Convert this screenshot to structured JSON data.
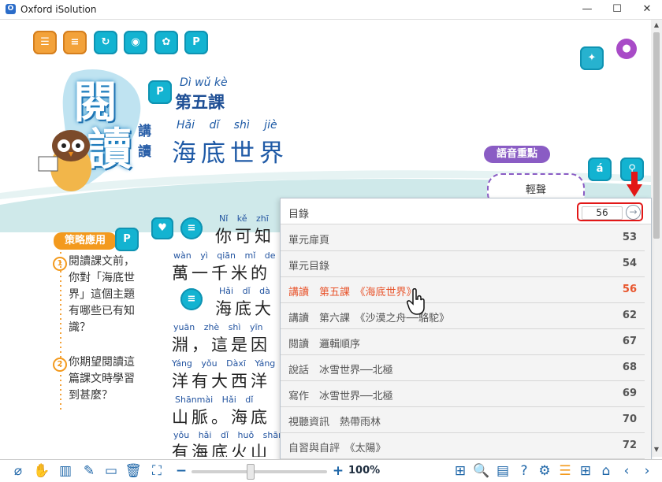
{
  "window": {
    "title": "Oxford iSolution",
    "logo_text": "O"
  },
  "header": {
    "brand_chars": [
      "閱",
      "讀"
    ],
    "side_label_top": "講",
    "side_label_bottom": "讀",
    "lesson_pinyin": "Dì wǔ kè",
    "lesson_title": "第五課",
    "lesson_name_pinyin": "Hǎi dǐ shì jiè",
    "lesson_name": "海底世界"
  },
  "speech_point": {
    "badge": "語音重點",
    "value": "輕聲"
  },
  "strategy": {
    "tag": "策略應用",
    "items": [
      {
        "num": "1",
        "lines": [
          "閱讀課文前，",
          "你對「海底世",
          "界」這個主題",
          "有哪些已有知",
          "識？"
        ]
      },
      {
        "num": "2",
        "lines": [
          "你期望閱讀這",
          "篇課文時學習",
          "到甚麼？"
        ]
      }
    ]
  },
  "lesson_lines": [
    {
      "py": "Nǐ kě zhī",
      "text": "你可知"
    },
    {
      "py": "wàn yì qiān mǐ de",
      "text": "萬一千米的"
    },
    {
      "py": "Hǎi dǐ dà",
      "text": "海底大"
    },
    {
      "py": "yuān zhè shì yīn",
      "text": "淵，這是因"
    },
    {
      "py": "Yáng yǒu Dàxī Yáng",
      "text": "洋有大西洋"
    },
    {
      "py": "Shānmài Hǎi dǐ",
      "text": "山脈。海底"
    },
    {
      "py": "yǒu hǎi dǐ huǒ shān",
      "text": "有海底火山"
    }
  ],
  "toc": {
    "title": "目錄",
    "page_input": "56",
    "go_icon": "arrow-right-circle-icon",
    "rows": [
      {
        "label": "單元扉頁",
        "page": "53",
        "active": false
      },
      {
        "label": "單元目錄",
        "page": "54",
        "active": false
      },
      {
        "label": "講讀　第五課　《海底世界》",
        "page": "56",
        "active": true
      },
      {
        "label": "講讀　第六課　《沙漠之舟──駱駝》",
        "page": "62",
        "active": false
      },
      {
        "label": "閱讀　邏輯順序",
        "page": "67",
        "active": false
      },
      {
        "label": "說話　冰雪世界──北極",
        "page": "68",
        "active": false
      },
      {
        "label": "寫作　冰雪世界──北極",
        "page": "69",
        "active": false
      },
      {
        "label": "視聽資訊　熱帶雨林",
        "page": "70",
        "active": false
      },
      {
        "label": "自習與自評　《太陽》",
        "page": "72",
        "active": false
      }
    ]
  },
  "bottom": {
    "zoom_minus": "−",
    "zoom_plus": "+",
    "zoom_label": "100%",
    "zoom_level_percent": 100
  },
  "colors": {
    "accent": "#13b3d1",
    "active_row": "#e8552d",
    "highlight": "#e21717"
  }
}
